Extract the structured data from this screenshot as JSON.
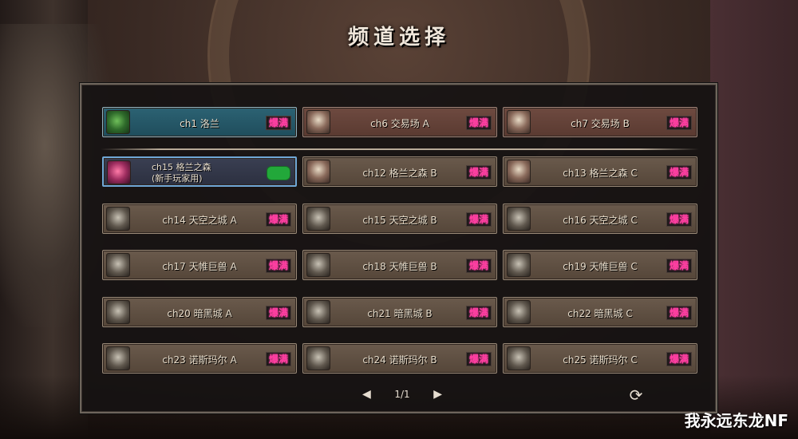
{
  "title": "频道选择",
  "colors": {
    "status_busy": "#ff3fa2",
    "status_ok": "#22a83a",
    "selected_border": "#6fa7d6",
    "current_bg": "#1f4d5c"
  },
  "top_channels": [
    {
      "name": "ch1 洛兰",
      "status": "爆满",
      "portrait": "leaf-icon",
      "style": "current"
    },
    {
      "name": "ch6 交易场 A",
      "status": "爆满",
      "portrait": "trader-icon",
      "style": "trade"
    },
    {
      "name": "ch7 交易场 B",
      "status": "爆满",
      "portrait": "trader-icon",
      "style": "trade"
    }
  ],
  "rookie_channel": {
    "name_line1": "ch15 格兰之森",
    "name_line2": "(新手玩家用)",
    "status": "",
    "portrait": "girl-icon"
  },
  "channels": [
    {
      "name": "ch12 格兰之森 B",
      "status": "爆满",
      "portrait": "trader-icon"
    },
    {
      "name": "ch13 格兰之森 C",
      "status": "爆满",
      "portrait": "trader-icon"
    },
    {
      "name": "ch14 天空之城 A",
      "status": "爆满",
      "portrait": "beast-icon"
    },
    {
      "name": "ch15 天空之城 B",
      "status": "爆满",
      "portrait": "beast-icon"
    },
    {
      "name": "ch16 天空之城 C",
      "status": "爆满",
      "portrait": "beast-icon"
    },
    {
      "name": "ch17 天帷巨兽 A",
      "status": "爆满",
      "portrait": "beast-icon"
    },
    {
      "name": "ch18 天帷巨兽 B",
      "status": "爆满",
      "portrait": "beast-icon"
    },
    {
      "name": "ch19 天帷巨兽 C",
      "status": "爆满",
      "portrait": "beast-icon"
    },
    {
      "name": "ch20 暗黑城 A",
      "status": "爆满",
      "portrait": "beast-icon"
    },
    {
      "name": "ch21 暗黑城 B",
      "status": "爆满",
      "portrait": "beast-icon"
    },
    {
      "name": "ch22 暗黑城 C",
      "status": "爆满",
      "portrait": "beast-icon"
    },
    {
      "name": "ch23 诺斯玛尔 A",
      "status": "爆满",
      "portrait": "beast-icon"
    },
    {
      "name": "ch24 诺斯玛尔 B",
      "status": "爆满",
      "portrait": "beast-icon"
    },
    {
      "name": "ch25 诺斯玛尔 C",
      "status": "爆满",
      "portrait": "beast-icon"
    }
  ],
  "pager": {
    "text": "1/1",
    "prev": "◀",
    "next": "▶"
  },
  "refresh_glyph": "⟳",
  "watermark": "我永远东龙NF"
}
